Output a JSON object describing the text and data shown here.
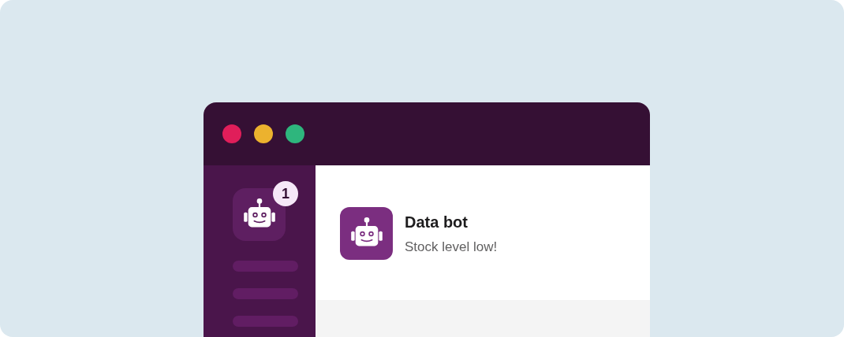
{
  "sidebar": {
    "app": {
      "badge": "1"
    },
    "nav_items": [
      {
        "kind": "placeholder"
      },
      {
        "kind": "placeholder"
      },
      {
        "kind": "placeholder"
      }
    ]
  },
  "notification": {
    "title": "Data bot",
    "message": "Stock level low!"
  }
}
